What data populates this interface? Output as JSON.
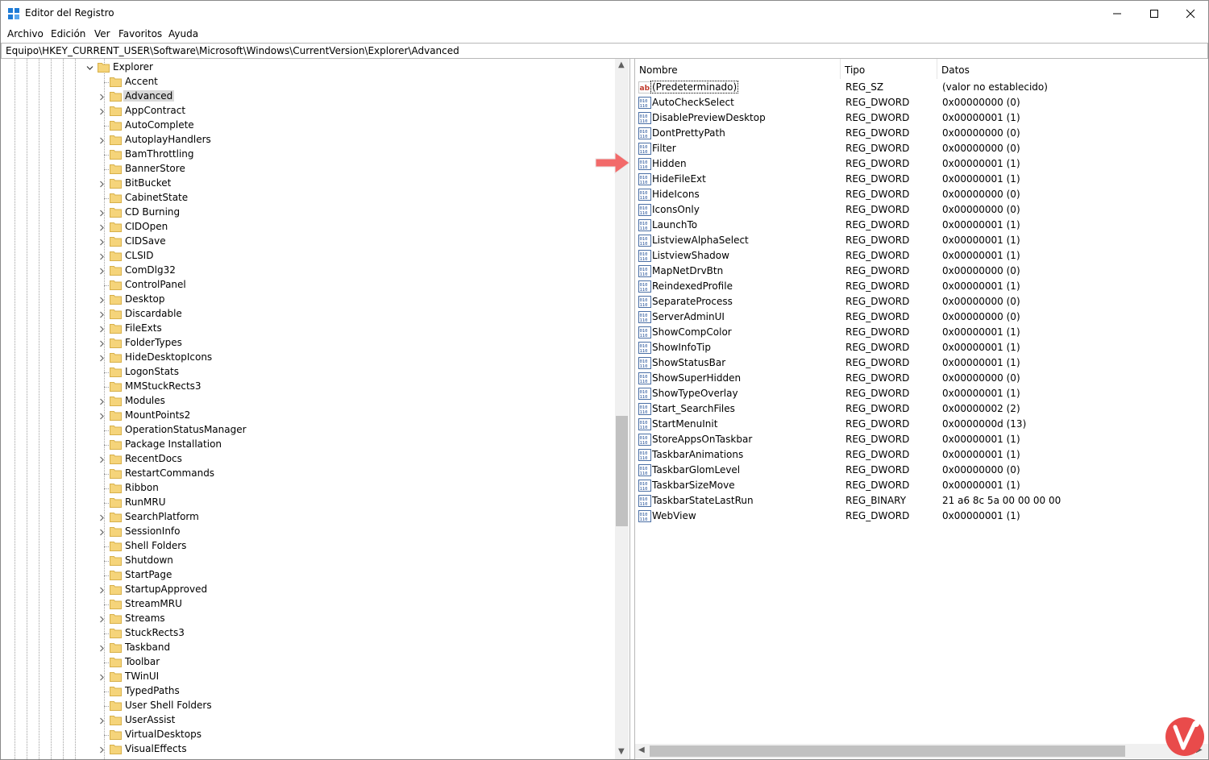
{
  "window": {
    "title": "Editor del Registro"
  },
  "menu": [
    "Archivo",
    "Edición",
    "Ver",
    "Favoritos",
    "Ayuda"
  ],
  "address": "Equipo\\HKEY_CURRENT_USER\\Software\\Microsoft\\Windows\\CurrentVersion\\Explorer\\Advanced",
  "tree": {
    "parent": "Explorer",
    "selected": "Advanced",
    "children": [
      {
        "label": "Accent",
        "expandable": false
      },
      {
        "label": "Advanced",
        "expandable": true
      },
      {
        "label": "AppContract",
        "expandable": true
      },
      {
        "label": "AutoComplete",
        "expandable": false
      },
      {
        "label": "AutoplayHandlers",
        "expandable": true
      },
      {
        "label": "BamThrottling",
        "expandable": false
      },
      {
        "label": "BannerStore",
        "expandable": false
      },
      {
        "label": "BitBucket",
        "expandable": true
      },
      {
        "label": "CabinetState",
        "expandable": false
      },
      {
        "label": "CD Burning",
        "expandable": true
      },
      {
        "label": "CIDOpen",
        "expandable": true
      },
      {
        "label": "CIDSave",
        "expandable": true
      },
      {
        "label": "CLSID",
        "expandable": true
      },
      {
        "label": "ComDlg32",
        "expandable": true
      },
      {
        "label": "ControlPanel",
        "expandable": false
      },
      {
        "label": "Desktop",
        "expandable": true
      },
      {
        "label": "Discardable",
        "expandable": true
      },
      {
        "label": "FileExts",
        "expandable": true
      },
      {
        "label": "FolderTypes",
        "expandable": true
      },
      {
        "label": "HideDesktopIcons",
        "expandable": true
      },
      {
        "label": "LogonStats",
        "expandable": false
      },
      {
        "label": "MMStuckRects3",
        "expandable": false
      },
      {
        "label": "Modules",
        "expandable": true
      },
      {
        "label": "MountPoints2",
        "expandable": true
      },
      {
        "label": "OperationStatusManager",
        "expandable": false
      },
      {
        "label": "Package Installation",
        "expandable": false
      },
      {
        "label": "RecentDocs",
        "expandable": true
      },
      {
        "label": "RestartCommands",
        "expandable": false
      },
      {
        "label": "Ribbon",
        "expandable": false
      },
      {
        "label": "RunMRU",
        "expandable": false
      },
      {
        "label": "SearchPlatform",
        "expandable": true
      },
      {
        "label": "SessionInfo",
        "expandable": true
      },
      {
        "label": "Shell Folders",
        "expandable": false
      },
      {
        "label": "Shutdown",
        "expandable": false
      },
      {
        "label": "StartPage",
        "expandable": false
      },
      {
        "label": "StartupApproved",
        "expandable": true
      },
      {
        "label": "StreamMRU",
        "expandable": false
      },
      {
        "label": "Streams",
        "expandable": true
      },
      {
        "label": "StuckRects3",
        "expandable": false
      },
      {
        "label": "Taskband",
        "expandable": true
      },
      {
        "label": "Toolbar",
        "expandable": false
      },
      {
        "label": "TWinUI",
        "expandable": true
      },
      {
        "label": "TypedPaths",
        "expandable": false
      },
      {
        "label": "User Shell Folders",
        "expandable": false
      },
      {
        "label": "UserAssist",
        "expandable": true
      },
      {
        "label": "VirtualDesktops",
        "expandable": false
      },
      {
        "label": "VisualEffects",
        "expandable": true
      }
    ]
  },
  "columns": [
    "Nombre",
    "Tipo",
    "Datos"
  ],
  "values": [
    {
      "name": "(Predeterminado)",
      "type": "REG_SZ",
      "data": "(valor no establecido)",
      "icon": "string-value-icon"
    },
    {
      "name": "AutoCheckSelect",
      "type": "REG_DWORD",
      "data": "0x00000000 (0)",
      "icon": "binary-value-icon"
    },
    {
      "name": "DisablePreviewDesktop",
      "type": "REG_DWORD",
      "data": "0x00000001 (1)",
      "icon": "binary-value-icon"
    },
    {
      "name": "DontPrettyPath",
      "type": "REG_DWORD",
      "data": "0x00000000 (0)",
      "icon": "binary-value-icon"
    },
    {
      "name": "Filter",
      "type": "REG_DWORD",
      "data": "0x00000000 (0)",
      "icon": "binary-value-icon"
    },
    {
      "name": "Hidden",
      "type": "REG_DWORD",
      "data": "0x00000001 (1)",
      "icon": "binary-value-icon"
    },
    {
      "name": "HideFileExt",
      "type": "REG_DWORD",
      "data": "0x00000001 (1)",
      "icon": "binary-value-icon"
    },
    {
      "name": "HideIcons",
      "type": "REG_DWORD",
      "data": "0x00000000 (0)",
      "icon": "binary-value-icon"
    },
    {
      "name": "IconsOnly",
      "type": "REG_DWORD",
      "data": "0x00000000 (0)",
      "icon": "binary-value-icon"
    },
    {
      "name": "LaunchTo",
      "type": "REG_DWORD",
      "data": "0x00000001 (1)",
      "icon": "binary-value-icon"
    },
    {
      "name": "ListviewAlphaSelect",
      "type": "REG_DWORD",
      "data": "0x00000001 (1)",
      "icon": "binary-value-icon"
    },
    {
      "name": "ListviewShadow",
      "type": "REG_DWORD",
      "data": "0x00000001 (1)",
      "icon": "binary-value-icon"
    },
    {
      "name": "MapNetDrvBtn",
      "type": "REG_DWORD",
      "data": "0x00000000 (0)",
      "icon": "binary-value-icon"
    },
    {
      "name": "ReindexedProfile",
      "type": "REG_DWORD",
      "data": "0x00000001 (1)",
      "icon": "binary-value-icon"
    },
    {
      "name": "SeparateProcess",
      "type": "REG_DWORD",
      "data": "0x00000000 (0)",
      "icon": "binary-value-icon"
    },
    {
      "name": "ServerAdminUI",
      "type": "REG_DWORD",
      "data": "0x00000000 (0)",
      "icon": "binary-value-icon"
    },
    {
      "name": "ShowCompColor",
      "type": "REG_DWORD",
      "data": "0x00000001 (1)",
      "icon": "binary-value-icon"
    },
    {
      "name": "ShowInfoTip",
      "type": "REG_DWORD",
      "data": "0x00000001 (1)",
      "icon": "binary-value-icon"
    },
    {
      "name": "ShowStatusBar",
      "type": "REG_DWORD",
      "data": "0x00000001 (1)",
      "icon": "binary-value-icon"
    },
    {
      "name": "ShowSuperHidden",
      "type": "REG_DWORD",
      "data": "0x00000000 (0)",
      "icon": "binary-value-icon"
    },
    {
      "name": "ShowTypeOverlay",
      "type": "REG_DWORD",
      "data": "0x00000001 (1)",
      "icon": "binary-value-icon"
    },
    {
      "name": "Start_SearchFiles",
      "type": "REG_DWORD",
      "data": "0x00000002 (2)",
      "icon": "binary-value-icon"
    },
    {
      "name": "StartMenuInit",
      "type": "REG_DWORD",
      "data": "0x0000000d (13)",
      "icon": "binary-value-icon"
    },
    {
      "name": "StoreAppsOnTaskbar",
      "type": "REG_DWORD",
      "data": "0x00000001 (1)",
      "icon": "binary-value-icon"
    },
    {
      "name": "TaskbarAnimations",
      "type": "REG_DWORD",
      "data": "0x00000001 (1)",
      "icon": "binary-value-icon"
    },
    {
      "name": "TaskbarGlomLevel",
      "type": "REG_DWORD",
      "data": "0x00000000 (0)",
      "icon": "binary-value-icon"
    },
    {
      "name": "TaskbarSizeMove",
      "type": "REG_DWORD",
      "data": "0x00000001 (1)",
      "icon": "binary-value-icon"
    },
    {
      "name": "TaskbarStateLastRun",
      "type": "REG_BINARY",
      "data": "21 a6 8c 5a 00 00 00 00",
      "icon": "binary-value-icon"
    },
    {
      "name": "WebView",
      "type": "REG_DWORD",
      "data": "0x00000001 (1)",
      "icon": "binary-value-icon"
    }
  ],
  "colors": {
    "folder": "#f5d47a",
    "annotation_arrow": "#f26a6a",
    "selection": "#d9d9d9",
    "logo": "#e94b4b"
  }
}
